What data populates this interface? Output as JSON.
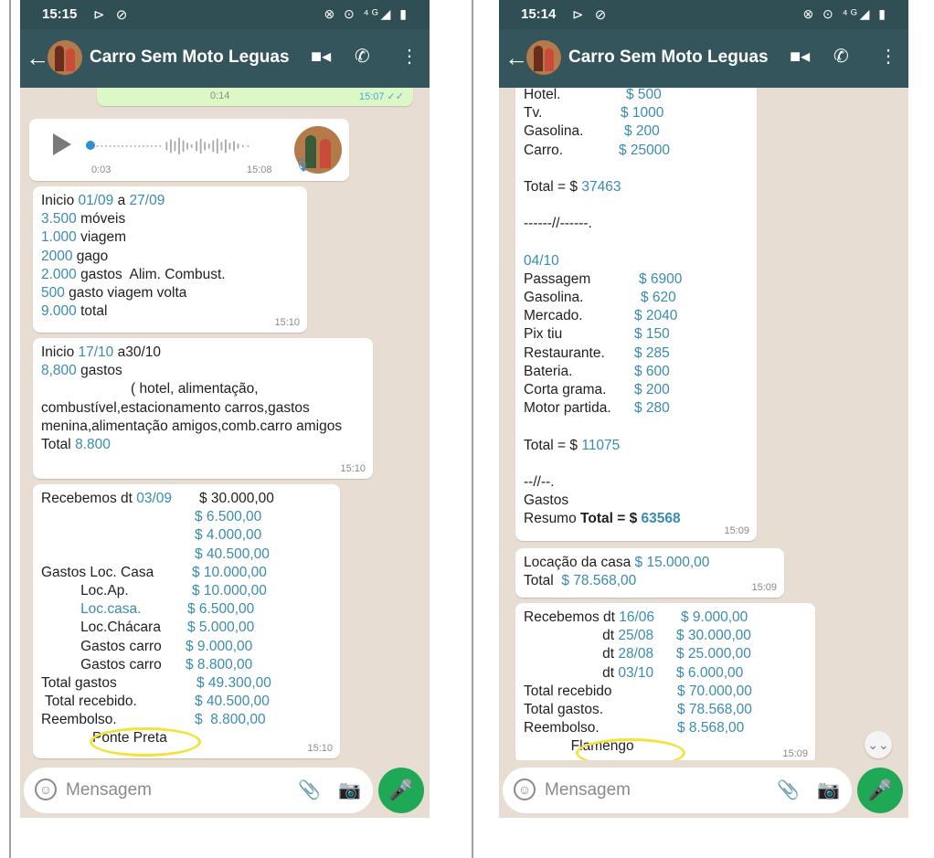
{
  "left": {
    "status_time": "15:15",
    "status_left_icons": "⊳ ⊘",
    "status_right_icons": "⊗ ⊙ ⁴ᴳ◢ ▮",
    "chat_title": "Carro Sem Moto Leguas",
    "icons": {
      "back": "back-arrow-icon",
      "video": "video-call-icon",
      "call": "phone-icon",
      "menu": "more-options-icon"
    },
    "top_voice": {
      "duration": "0:14",
      "time": "15:07 ✓✓"
    },
    "voice": {
      "duration": "0:03",
      "time": "15:08"
    },
    "msg1": {
      "lines": [
        {
          "k": "Inicio ",
          "b": "01/09",
          "k2": " a ",
          "b2": "27/09"
        },
        {
          "b": "3.500",
          "k": " móveis"
        },
        {
          "b": "1.000",
          "k": " viagem"
        },
        {
          "b": "2000",
          "k": " gago"
        },
        {
          "b": "2.000",
          "k": " gastos  Alim. Combust."
        },
        {
          "b": "500",
          "k": " gasto viagem volta"
        },
        {
          "b": "9.000",
          "k": " total"
        }
      ],
      "time": "15:10"
    },
    "msg2": {
      "l1k": "Inicio ",
      "l1b": "17/10",
      "l1k2": " a30/10",
      "l2b": "8,800",
      "l2k": " gastos",
      "l3": "( hotel, alimentação,",
      "l4": "combustível,estacionamento carros,gastos menina,alimentação amigos,comb.carro amigos",
      "l5k": "Total ",
      "l5b": "8.800",
      "time": "15:10"
    },
    "msg3": {
      "rows": [
        {
          "label": "Recebemos dt ",
          "labelb": "03/09",
          "value": "$ 30.000,00",
          "vx": 173,
          "blue_value": false
        },
        {
          "label": "",
          "labelb": "",
          "value": "$ 6.500,00",
          "vx": 168,
          "blue_value": true
        },
        {
          "label": "",
          "labelb": "",
          "value": "$ 4.000,00",
          "vx": 168,
          "blue_value": true
        },
        {
          "label": "",
          "labelb": "",
          "value": "$ 40.500,00",
          "vx": 168,
          "blue_value": true
        },
        {
          "label": "Gastos Loc. Casa",
          "labelb": "",
          "value": "$ 10.000,00",
          "vx": 165,
          "blue_value": true
        },
        {
          "label": "          Loc.Ap.",
          "labelb": "",
          "value": "$ 10.000,00",
          "vx": 165,
          "blue_value": true
        },
        {
          "label": "",
          "labelb": "          Loc.casa.",
          "value": "$ 6.500,00",
          "vx": 160,
          "blue_value": true
        },
        {
          "label": "          Loc.Chácara",
          "labelb": "",
          "value": "$ 5.000,00",
          "vx": 160,
          "blue_value": true
        },
        {
          "label": "          Gastos carro",
          "labelb": "",
          "value": "$ 9.000,00",
          "vx": 158,
          "blue_value": true
        },
        {
          "label": "          Gastos carro",
          "labelb": "",
          "value": "$ 8.800,00",
          "vx": 158,
          "blue_value": true
        },
        {
          "label": "Total gastos",
          "labelb": "",
          "value": "$ 49.300,00",
          "vx": 170,
          "blue_value": true
        },
        {
          "label": " Total recebido.",
          "labelb": "",
          "value": "$ 40.500,00",
          "vx": 168,
          "blue_value": true
        },
        {
          "label": "Reembolso.",
          "labelb": "",
          "value": "$  8.800,00",
          "vx": 168,
          "blue_value": true
        },
        {
          "label": "             Ponte Preta",
          "labelb": "",
          "value": "",
          "vx": 0,
          "blue_value": false
        }
      ],
      "time": "15:10"
    },
    "input_placeholder": "Mensagem"
  },
  "right": {
    "status_time": "15:14",
    "status_left_icons": "⊳ ⊘",
    "status_right_icons": "⊗ ⊙ ⁴ᴳ◢ ▮",
    "chat_title": "Carro Sem Moto Leguas",
    "msg1": {
      "rows": [
        {
          "label": "Hotel.",
          "value": "$ 500",
          "vx": 112
        },
        {
          "label": "Tv.",
          "value": "$ 1000",
          "vx": 106
        },
        {
          "label": "Gasolina.",
          "value": "$ 200",
          "vx": 110
        },
        {
          "label": "Carro.",
          "value": "$ 25000",
          "vx": 104
        }
      ],
      "total1k": "Total = $ ",
      "total1b": "37463",
      "sep1": "------//------.",
      "date": "04/10",
      "rows2": [
        {
          "label": "Passagem",
          "value": "$ 6900",
          "vx": 126
        },
        {
          "label": "Gasolina.",
          "value": "$ 620",
          "vx": 128
        },
        {
          "label": "Mercado.",
          "value": "$ 2040",
          "vx": 121
        },
        {
          "label": "Pix tiu",
          "value": "$ 150",
          "vx": 121
        },
        {
          "label": "Restaurante.",
          "value": "$ 285",
          "vx": 121
        },
        {
          "label": "Bateria.",
          "value": "$ 600",
          "vx": 121
        },
        {
          "label": "Corta grama.",
          "value": "$ 200",
          "vx": 121
        },
        {
          "label": "Motor partida.",
          "value": "$ 280",
          "vx": 121
        }
      ],
      "total2k": "Total = $ ",
      "total2b": "11075",
      "sep2": "--//--.",
      "gastos": "Gastos",
      "resumo_k": "Resumo ",
      "resumo_bold": "Total = $ ",
      "resumo_val": "63568",
      "time": "15:09"
    },
    "msg2": {
      "l1k": "Locação da casa ",
      "l1b": "$ 15.000,00",
      "l2k": "Total  ",
      "l2b": "$ 78.568,00",
      "time": "15:09"
    },
    "msg3": {
      "rows": [
        {
          "label": "Recebemos dt ",
          "labelb": "16/06",
          "value": "$ 9.000,00",
          "vx": 172
        },
        {
          "label": "                    dt ",
          "labelb": "25/08",
          "value": "$ 30.000,00",
          "vx": 167
        },
        {
          "label": "                    dt ",
          "labelb": "28/08",
          "value": "$ 25.000,00",
          "vx": 167
        },
        {
          "label": "                    dt ",
          "labelb": "03/10",
          "value": "$ 6.000,00",
          "vx": 167
        },
        {
          "label": "Total recebido",
          "labelb": "",
          "value": "$ 70.000,00",
          "vx": 168
        },
        {
          "label": "Total gastos.",
          "labelb": "",
          "value": "$ 78.568,00",
          "vx": 168
        },
        {
          "label": "Reembolso.",
          "labelb": "",
          "value": "$ 8.568,00",
          "vx": 168
        },
        {
          "label": "            Flamengo",
          "labelb": "",
          "value": "",
          "vx": 0
        }
      ],
      "time": "15:09"
    },
    "scroll_icon": "double-chevron-down-icon",
    "input_placeholder": "Mensagem"
  }
}
